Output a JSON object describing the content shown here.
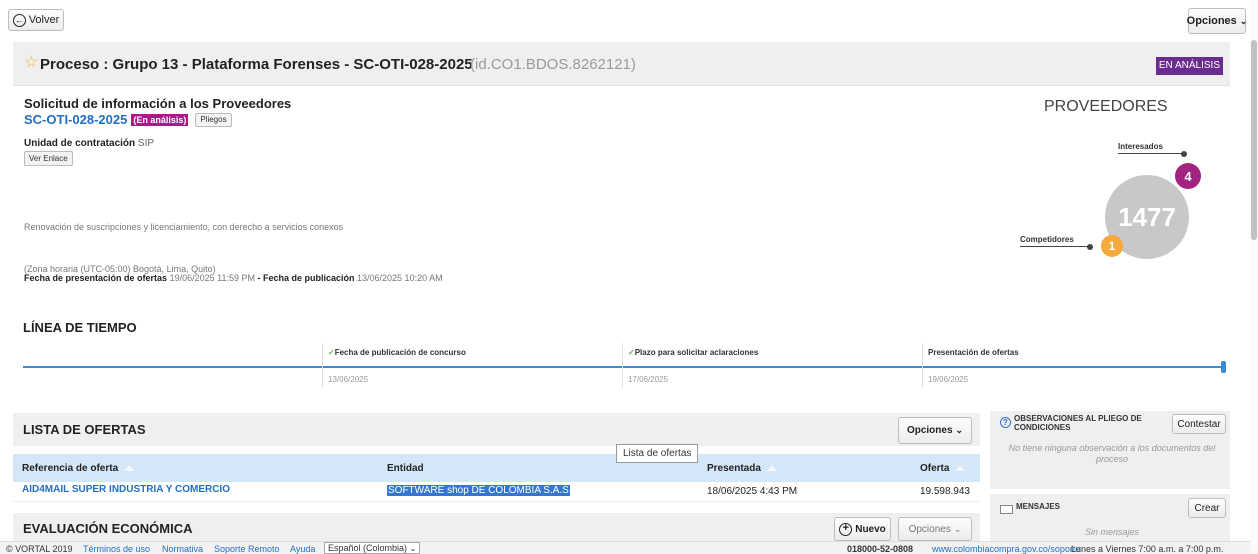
{
  "nav": {
    "back_label": "Volver",
    "options_label": "Opciones"
  },
  "header": {
    "title": "Proceso : Grupo 13 - Plataforma Forenses - SC-OTI-028-2025",
    "id_label": "(id.CO1.BDOS.8262121)",
    "status_badge": "EN ANÁLISIS"
  },
  "info": {
    "subtitle": "Solicitud de información a los Proveedores",
    "reference": "SC-OTI-028-2025",
    "status_tag": "(En análisis)",
    "pliegos_label": "Pliegos",
    "unit_label": "Unidad de contratación",
    "unit_value": "SIP",
    "ver_enlace_label": "Ver Enlace",
    "description": "Renovación de suscripciones y licenciamiento, con derecho a servicios conexos",
    "timezone": "(Zona horaria (UTC-05:00) Bogotá, Lima, Quito)",
    "presentation_label": "Fecha de presentación de ofertas",
    "presentation_date": "19/06/2025 11:59 PM",
    "separator": " - ",
    "publication_label": "Fecha de publicación",
    "publication_date": "13/06/2025 10:20 AM"
  },
  "providers": {
    "title": "PROVEEDORES",
    "interested_label": "Interesados",
    "interested_count": "4",
    "total": "1477",
    "competitors_label": "Competidores",
    "competitors_count": "1"
  },
  "timeline": {
    "title": "LÍNEA DE TIEMPO",
    "items": [
      {
        "label": "Fecha de publicación de concurso",
        "date": "13/06/2025"
      },
      {
        "label": "Plazo para solicitar aclaraciones",
        "date": "17/06/2025"
      },
      {
        "label": "Presentación de ofertas",
        "date": "19/06/2025"
      }
    ]
  },
  "offers": {
    "title": "LISTA DE OFERTAS",
    "options_label": "Opciones",
    "tooltip": "Lista de ofertas",
    "columns": [
      "Referencia de oferta",
      "Entidad",
      "Presentada",
      "Oferta"
    ],
    "rows": [
      {
        "reference": "AID4MAIL SUPER INDUSTRIA Y COMERCIO",
        "entity": "SOFTWARE shop DE COLOMBIA S.A.S",
        "date": "18/06/2025 4:43 PM",
        "amount": "19.598.943"
      }
    ]
  },
  "evaluation": {
    "title": "EVALUACIÓN ECONÓMICA",
    "new_label": "Nuevo",
    "options_label": "Opciones"
  },
  "observations": {
    "title": "OBSERVACIONES AL PLIEGO DE CONDICIONES",
    "button_label": "Contestar",
    "empty_text": "No tiene ninguna observación a los documentos del proceso"
  },
  "messages": {
    "title": "MENSAJES",
    "button_label": "Crear",
    "empty_text": "Sin mensajes"
  },
  "footer": {
    "copyright": "© VORTAL 2019",
    "links": [
      "Términos de uso",
      "Normativa",
      "Soporte Remoto",
      "Ayuda"
    ],
    "language": "Español (Colombia)",
    "phone": "018000-52-0808",
    "support_url": "www.colombiacompra.gov.co/soporte",
    "hours": "Lunes a Viernes 7:00 a.m. a 7:00 p.m."
  },
  "colors": {
    "accent_blue": "#1f6fc5",
    "badge_purple": "#6b2c8f",
    "tag_magenta": "#b0168c",
    "orange": "#f5a93b",
    "row_highlight": "#cce3f6"
  }
}
